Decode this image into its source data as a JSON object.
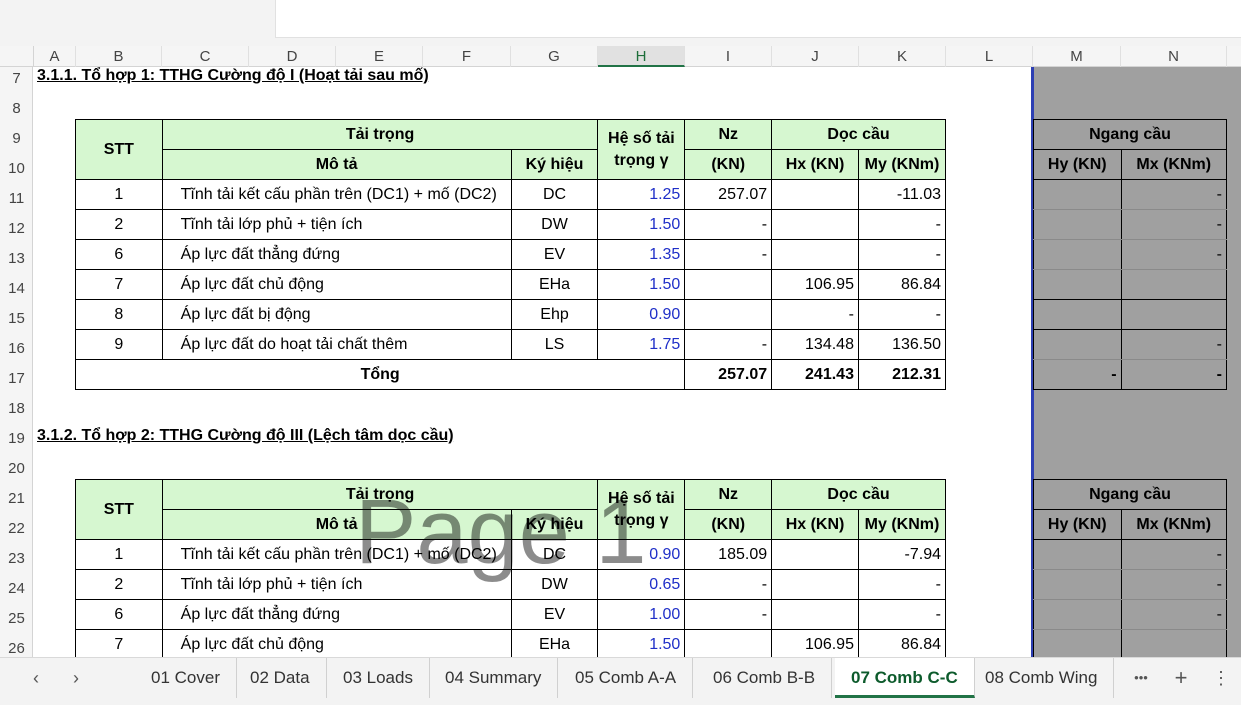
{
  "columns": [
    "A",
    "B",
    "C",
    "D",
    "E",
    "F",
    "G",
    "H",
    "I",
    "J",
    "K",
    "L",
    "M",
    "N"
  ],
  "selected_column": "H",
  "rows": [
    "7",
    "8",
    "9",
    "10",
    "11",
    "12",
    "13",
    "14",
    "15",
    "16",
    "17",
    "18",
    "19",
    "20",
    "21",
    "22",
    "23",
    "24",
    "25",
    "26"
  ],
  "section1": {
    "heading": "3.1.1. Tổ hợp 1: TTHG Cường độ I (Hoạt tải sau mố)",
    "headers": {
      "stt": "STT",
      "tai_trong": "Tải trọng",
      "mo_ta": "Mô tả",
      "ky_hieu": "Ký hiệu",
      "he_so_1": "Hệ số tải",
      "he_so_2": "trọng γ",
      "nz": "Nz",
      "nz_unit": "(KN)",
      "doc_cau": "Dọc cầu",
      "hx": "Hx (KN)",
      "my": "My (KNm)",
      "ngang_cau": "Ngang cầu",
      "hy": "Hy (KN)",
      "mx": "Mx (KNm)"
    },
    "rows": [
      {
        "stt": "1",
        "desc": "Tĩnh tải kết cấu phần trên (DC1) + mố (DC2)",
        "sym": "DC",
        "factor": "1.25",
        "nz": "257.07",
        "hx": "",
        "my": "-11.03",
        "hy": "",
        "mx": "-"
      },
      {
        "stt": "2",
        "desc": "Tĩnh tải lớp phủ + tiện ích",
        "sym": "DW",
        "factor": "1.50",
        "nz": "-",
        "hx": "",
        "my": "-",
        "hy": "",
        "mx": "-"
      },
      {
        "stt": "6",
        "desc": "Áp lực đất thẳng đứng",
        "sym": "EV",
        "factor": "1.35",
        "nz": "-",
        "hx": "",
        "my": "-",
        "hy": "",
        "mx": "-"
      },
      {
        "stt": "7",
        "desc": "Áp lực đất chủ động",
        "sym": "EHa",
        "factor": "1.50",
        "nz": "",
        "hx": "106.95",
        "my": "86.84",
        "hy": "",
        "mx": ""
      },
      {
        "stt": "8",
        "desc": "Áp lực đất bị động",
        "sym": "Ehp",
        "factor": "0.90",
        "nz": "",
        "hx": "-",
        "my": "-",
        "hy": "",
        "mx": ""
      },
      {
        "stt": "9",
        "desc": "Áp lực đất do hoạt tải chất thêm",
        "sym": "LS",
        "factor": "1.75",
        "nz": "-",
        "hx": "134.48",
        "my": "136.50",
        "hy": "",
        "mx": "-"
      }
    ],
    "total": {
      "label": "Tổng",
      "nz": "257.07",
      "hx": "241.43",
      "my": "212.31",
      "hy": "-",
      "mx": "-"
    }
  },
  "section2": {
    "heading": "3.1.2. Tổ hợp 2: TTHG Cường độ III (Lệch tâm dọc cầu)",
    "rows": [
      {
        "stt": "1",
        "desc": "Tĩnh tải kết cấu phần trên (DC1) + mố (DC2)",
        "sym": "DC",
        "factor": "0.90",
        "nz": "185.09",
        "hx": "",
        "my": "-7.94",
        "hy": "",
        "mx": "-"
      },
      {
        "stt": "2",
        "desc": "Tĩnh tải lớp phủ + tiện ích",
        "sym": "DW",
        "factor": "0.65",
        "nz": "-",
        "hx": "",
        "my": "-",
        "hy": "",
        "mx": "-"
      },
      {
        "stt": "6",
        "desc": "Áp lực đất thẳng đứng",
        "sym": "EV",
        "factor": "1.00",
        "nz": "-",
        "hx": "",
        "my": "-",
        "hy": "",
        "mx": "-"
      },
      {
        "stt": "7",
        "desc": "Áp lực đất chủ động",
        "sym": "EHa",
        "factor": "1.50",
        "nz": "",
        "hx": "106.95",
        "my": "86.84",
        "hy": "",
        "mx": ""
      }
    ]
  },
  "watermark": "Page 1",
  "tabs": [
    "01 Cover",
    "02 Data",
    "03 Loads",
    "04 Summary",
    "05 Comb A-A",
    "06 Comb B-B",
    "07 Comb C-C",
    "08 Comb Wing"
  ],
  "active_tab": "07 Comb C-C",
  "nav": {
    "prev": "‹",
    "next": "›",
    "more": "•••",
    "add": "+",
    "menu": "⋮"
  }
}
